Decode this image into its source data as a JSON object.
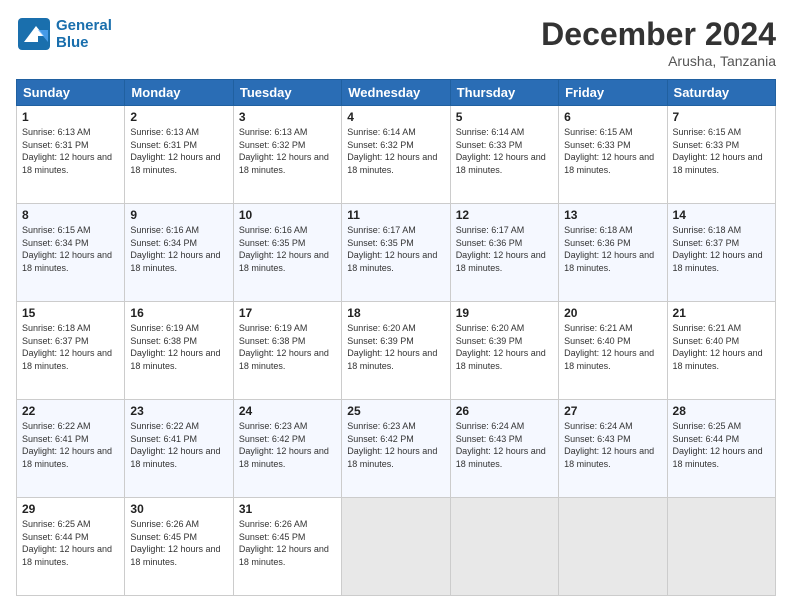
{
  "header": {
    "logo_line1": "General",
    "logo_line2": "Blue",
    "month": "December 2024",
    "location": "Arusha, Tanzania"
  },
  "days_of_week": [
    "Sunday",
    "Monday",
    "Tuesday",
    "Wednesday",
    "Thursday",
    "Friday",
    "Saturday"
  ],
  "weeks": [
    [
      {
        "day": "1",
        "sunrise": "6:13 AM",
        "sunset": "6:31 PM",
        "daylight": "12 hours and 18 minutes."
      },
      {
        "day": "2",
        "sunrise": "6:13 AM",
        "sunset": "6:31 PM",
        "daylight": "12 hours and 18 minutes."
      },
      {
        "day": "3",
        "sunrise": "6:13 AM",
        "sunset": "6:32 PM",
        "daylight": "12 hours and 18 minutes."
      },
      {
        "day": "4",
        "sunrise": "6:14 AM",
        "sunset": "6:32 PM",
        "daylight": "12 hours and 18 minutes."
      },
      {
        "day": "5",
        "sunrise": "6:14 AM",
        "sunset": "6:33 PM",
        "daylight": "12 hours and 18 minutes."
      },
      {
        "day": "6",
        "sunrise": "6:15 AM",
        "sunset": "6:33 PM",
        "daylight": "12 hours and 18 minutes."
      },
      {
        "day": "7",
        "sunrise": "6:15 AM",
        "sunset": "6:33 PM",
        "daylight": "12 hours and 18 minutes."
      }
    ],
    [
      {
        "day": "8",
        "sunrise": "6:15 AM",
        "sunset": "6:34 PM",
        "daylight": "12 hours and 18 minutes."
      },
      {
        "day": "9",
        "sunrise": "6:16 AM",
        "sunset": "6:34 PM",
        "daylight": "12 hours and 18 minutes."
      },
      {
        "day": "10",
        "sunrise": "6:16 AM",
        "sunset": "6:35 PM",
        "daylight": "12 hours and 18 minutes."
      },
      {
        "day": "11",
        "sunrise": "6:17 AM",
        "sunset": "6:35 PM",
        "daylight": "12 hours and 18 minutes."
      },
      {
        "day": "12",
        "sunrise": "6:17 AM",
        "sunset": "6:36 PM",
        "daylight": "12 hours and 18 minutes."
      },
      {
        "day": "13",
        "sunrise": "6:18 AM",
        "sunset": "6:36 PM",
        "daylight": "12 hours and 18 minutes."
      },
      {
        "day": "14",
        "sunrise": "6:18 AM",
        "sunset": "6:37 PM",
        "daylight": "12 hours and 18 minutes."
      }
    ],
    [
      {
        "day": "15",
        "sunrise": "6:18 AM",
        "sunset": "6:37 PM",
        "daylight": "12 hours and 18 minutes."
      },
      {
        "day": "16",
        "sunrise": "6:19 AM",
        "sunset": "6:38 PM",
        "daylight": "12 hours and 18 minutes."
      },
      {
        "day": "17",
        "sunrise": "6:19 AM",
        "sunset": "6:38 PM",
        "daylight": "12 hours and 18 minutes."
      },
      {
        "day": "18",
        "sunrise": "6:20 AM",
        "sunset": "6:39 PM",
        "daylight": "12 hours and 18 minutes."
      },
      {
        "day": "19",
        "sunrise": "6:20 AM",
        "sunset": "6:39 PM",
        "daylight": "12 hours and 18 minutes."
      },
      {
        "day": "20",
        "sunrise": "6:21 AM",
        "sunset": "6:40 PM",
        "daylight": "12 hours and 18 minutes."
      },
      {
        "day": "21",
        "sunrise": "6:21 AM",
        "sunset": "6:40 PM",
        "daylight": "12 hours and 18 minutes."
      }
    ],
    [
      {
        "day": "22",
        "sunrise": "6:22 AM",
        "sunset": "6:41 PM",
        "daylight": "12 hours and 18 minutes."
      },
      {
        "day": "23",
        "sunrise": "6:22 AM",
        "sunset": "6:41 PM",
        "daylight": "12 hours and 18 minutes."
      },
      {
        "day": "24",
        "sunrise": "6:23 AM",
        "sunset": "6:42 PM",
        "daylight": "12 hours and 18 minutes."
      },
      {
        "day": "25",
        "sunrise": "6:23 AM",
        "sunset": "6:42 PM",
        "daylight": "12 hours and 18 minutes."
      },
      {
        "day": "26",
        "sunrise": "6:24 AM",
        "sunset": "6:43 PM",
        "daylight": "12 hours and 18 minutes."
      },
      {
        "day": "27",
        "sunrise": "6:24 AM",
        "sunset": "6:43 PM",
        "daylight": "12 hours and 18 minutes."
      },
      {
        "day": "28",
        "sunrise": "6:25 AM",
        "sunset": "6:44 PM",
        "daylight": "12 hours and 18 minutes."
      }
    ],
    [
      {
        "day": "29",
        "sunrise": "6:25 AM",
        "sunset": "6:44 PM",
        "daylight": "12 hours and 18 minutes."
      },
      {
        "day": "30",
        "sunrise": "6:26 AM",
        "sunset": "6:45 PM",
        "daylight": "12 hours and 18 minutes."
      },
      {
        "day": "31",
        "sunrise": "6:26 AM",
        "sunset": "6:45 PM",
        "daylight": "12 hours and 18 minutes."
      },
      null,
      null,
      null,
      null
    ]
  ]
}
